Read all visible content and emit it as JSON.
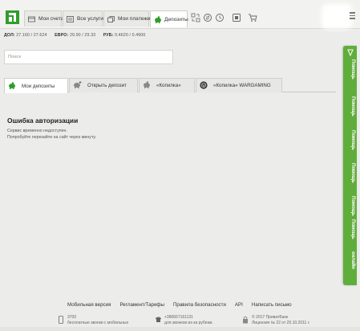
{
  "nav": {
    "tabs": [
      {
        "label": "Мои счета",
        "icon": "card-icon"
      },
      {
        "label": "Все услуги",
        "icon": "list-icon"
      },
      {
        "label": "Мои платежи",
        "icon": "payments-icon"
      },
      {
        "label": "Депозиты",
        "icon": "piggy-bank-icon"
      }
    ],
    "active_tab": "Депозиты",
    "icons": [
      "transfer-icon",
      "exchange-icon",
      "history-icon",
      "messages-icon",
      "shop-icon"
    ]
  },
  "rates": {
    "usd_label": "ДОЛ:",
    "usd_value": "27.160 / 27.624",
    "eur_label": "ЕВРО:",
    "eur_value": "29.90 / 29.33",
    "rub_label": "РУБ:",
    "rub_value": "0.4620 / 0.4900"
  },
  "search": {
    "placeholder": "Поиск"
  },
  "deposit_tabs": [
    {
      "label": "Мои депозиты",
      "icon": "piggy-bank-icon"
    },
    {
      "label": "Открыть депозит",
      "icon": "new-deposit-icon"
    },
    {
      "label": "«Копилка»",
      "icon": "piggy-bank-icon"
    },
    {
      "label": "«Копилка» WARGAMING",
      "icon": "wargaming-icon"
    }
  ],
  "content": {
    "error_title": "Ошибка авторизации",
    "error_line1": "Сервис временно недоступен.",
    "error_line2": "Попробуйте перезайти на сайт через минуту."
  },
  "help": {
    "labels": [
      "Помощь",
      "Помощь",
      "Помощь",
      "Помощь",
      "Помощь",
      "Помощь",
      "онлайн"
    ]
  },
  "footer": {
    "links": [
      "Мобильная версия",
      "Регламент/Тарифы",
      "Правила безопасности",
      "API",
      "Написать письмо"
    ],
    "phone1": "3700",
    "phone1_note": "бесплатные звонки с мобильных",
    "phone2": "+380667161131",
    "phone2_note": "для звонков из-за рубежа",
    "copyright_line1": "© 2017 ПриватБанк",
    "copyright_line2": "Лицензия № 22 от 25.10.2011 г."
  },
  "colors": {
    "brand_green": "#2f9d2a",
    "help_green": "#5fae3b"
  }
}
